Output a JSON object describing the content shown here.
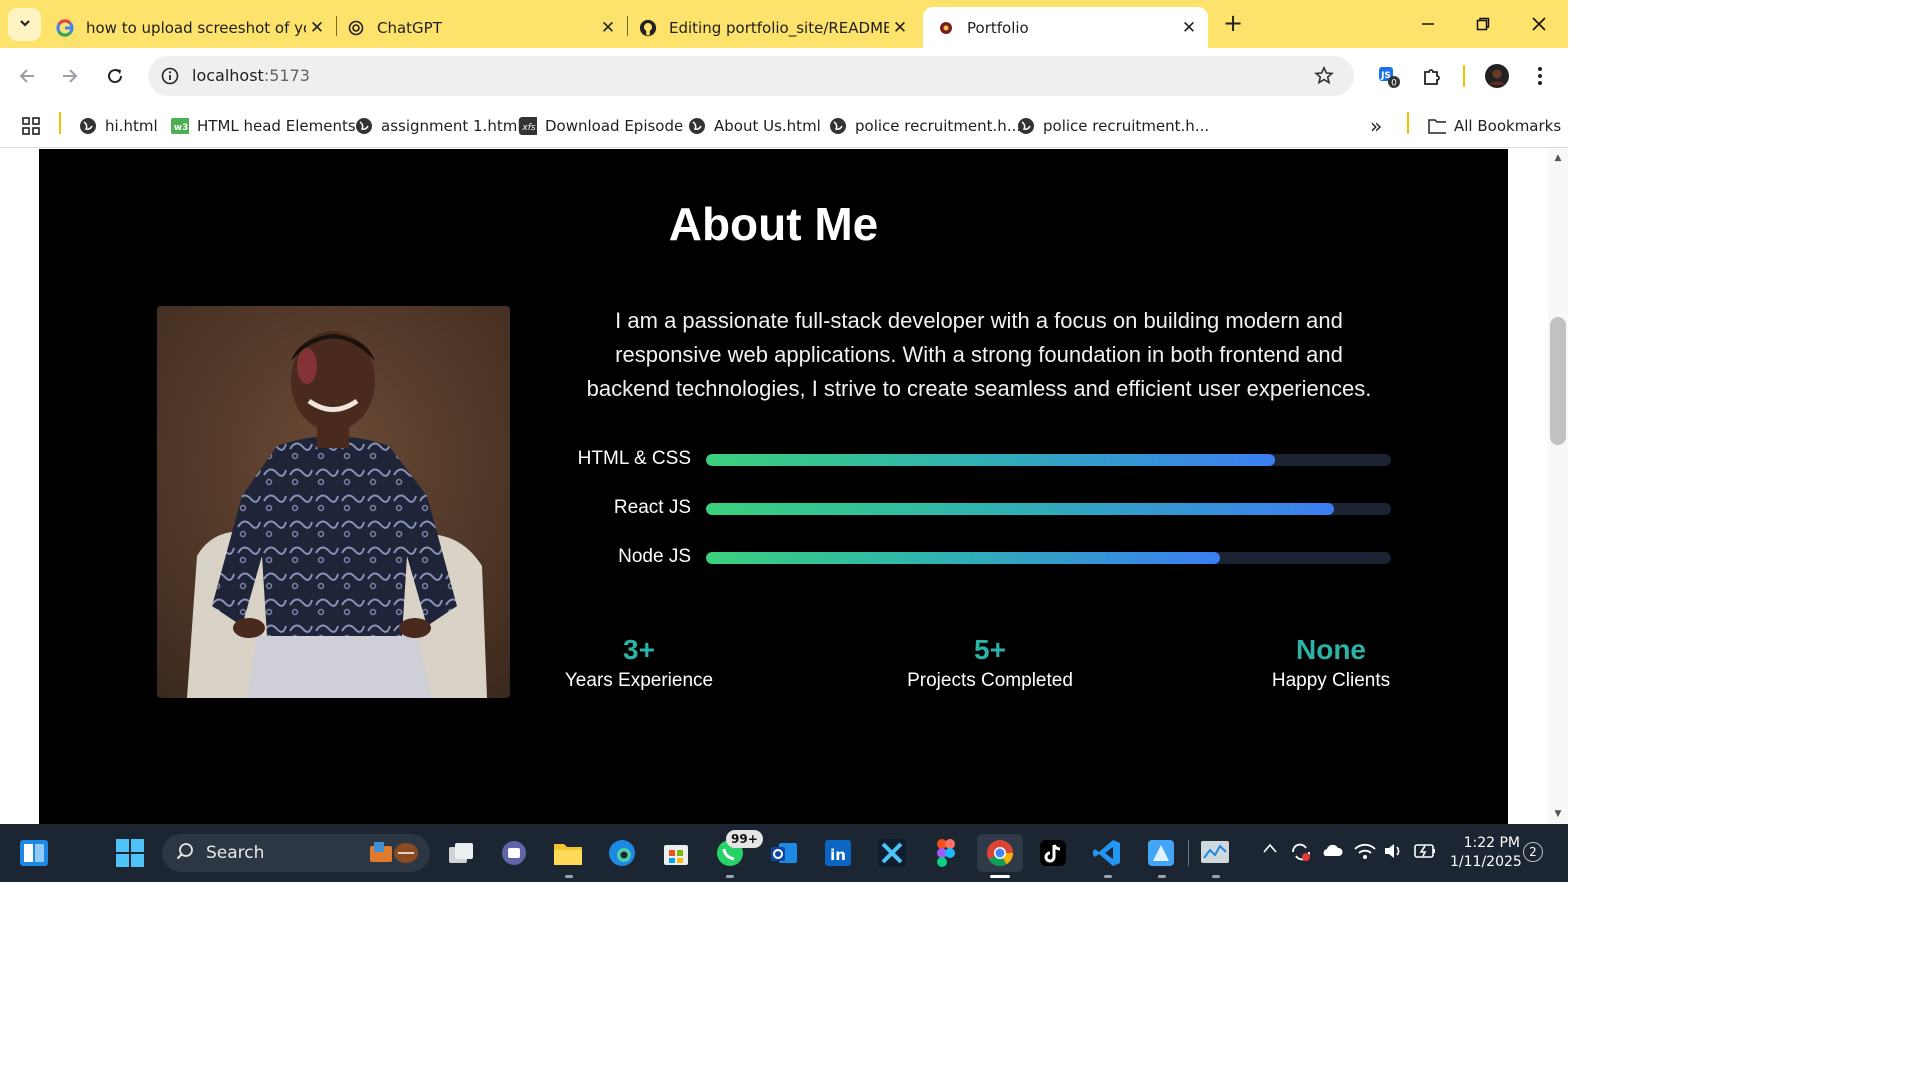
{
  "tabs": [
    {
      "title": "how to upload screeshot of you",
      "favicon": "google-icon"
    },
    {
      "title": "ChatGPT",
      "favicon": "chatgpt-icon"
    },
    {
      "title": "Editing portfolio_site/README.r",
      "favicon": "github-icon"
    },
    {
      "title": "Portfolio",
      "favicon": "react-icon",
      "active": true
    }
  ],
  "new_tab_label": "+",
  "address": {
    "host": "localhost",
    "port": ":5173"
  },
  "extensions_badge": "0",
  "bookmarks": [
    {
      "label": "hi.html",
      "icon": "globe-icon"
    },
    {
      "label": "HTML head Elements",
      "icon": "w3-icon"
    },
    {
      "label": "assignment 1.html",
      "icon": "globe-icon"
    },
    {
      "label": "Download Episode",
      "icon": "xfs-icon",
      "icon_text": "xfs"
    },
    {
      "label": "About Us.html",
      "icon": "globe-icon"
    },
    {
      "label": "police recruitment.h...",
      "icon": "globe-icon"
    },
    {
      "label": "police recruitment.h...",
      "icon": "globe-icon"
    }
  ],
  "bookmarks_overflow": "»",
  "all_bookmarks": "All Bookmarks",
  "page": {
    "title": "About Me",
    "bio_lines": [
      "I am a passionate full-stack developer with a focus on building modern and",
      "responsive web applications. With a strong foundation in both frontend and",
      "backend technologies, I strive to create seamless and efficient user experiences."
    ],
    "skills": [
      {
        "label": "HTML & CSS",
        "level": 0.83
      },
      {
        "label": "React JS",
        "level": 0.917
      },
      {
        "label": "Node JS",
        "level": 0.75
      }
    ],
    "stats": [
      {
        "value": "3+",
        "label": "Years Experience"
      },
      {
        "value": "5+",
        "label": "Projects Completed"
      },
      {
        "value": "None",
        "label": "Happy Clients"
      }
    ]
  },
  "taskbar": {
    "search_label": "Search",
    "whatsapp_badge": "99+",
    "clock_time": "1:22 PM",
    "clock_date": "1/11/2025",
    "notifications": "2"
  },
  "colors": {
    "tabstrip": "#fde26b",
    "accent_teal": "#2bb3a8",
    "bar_start": "#3ad17c",
    "bar_end": "#3b7df2",
    "section_bg": "#000000"
  }
}
